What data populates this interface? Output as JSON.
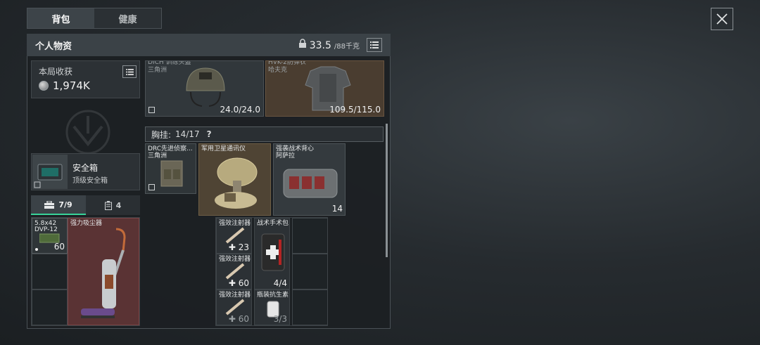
{
  "tabs": [
    {
      "label": "背包"
    },
    {
      "label": "健康"
    }
  ],
  "panel": {
    "title": "个人物资",
    "weight_current": "33.5",
    "weight_max": "/88千克"
  },
  "loot": {
    "title": "本局收获",
    "value": "1,974K"
  },
  "safe_box": {
    "name": "安全箱",
    "subtitle": "顶级安全箱"
  },
  "subtabs": [
    {
      "label": "7/9",
      "icon": "toolbox-icon"
    },
    {
      "label": "4",
      "icon": "canister-icon"
    }
  ],
  "left_items": {
    "ammo": {
      "label1": "5.8x42",
      "label2": "DVP-12",
      "count": "60"
    },
    "vacuum": {
      "label": "强力吸尘器"
    }
  },
  "equipment": {
    "helmet": {
      "label1": "DICH 训练头盔",
      "label2": "三角洲",
      "durability": "24.0/24.0"
    },
    "armor": {
      "label1": "HVK-2防弹衣",
      "label2": "哈夫克",
      "durability": "109.5/115.0"
    }
  },
  "chest_rig": {
    "label": "胸挂:",
    "capacity": "14/17",
    "help": "?"
  },
  "rig_items": {
    "rig": {
      "label1": "DRC先进侦察...",
      "label2": "三角洲"
    },
    "radio": {
      "label": "军用卫星通讯仪"
    },
    "backpack": {
      "label1": "强袭战术背心",
      "label2": "阿萨拉",
      "capacity": "14"
    }
  },
  "pouch_items": [
    {
      "label": "强效注射器",
      "count": "23"
    },
    {
      "label": "战术手术包",
      "count": "4/4"
    },
    {
      "label": "强效注射器",
      "count": "60"
    },
    {
      "label": "强效注射器",
      "count": "60"
    },
    {
      "label": "瓶装抗生素",
      "count": "3/3"
    }
  ],
  "colors": {
    "accent_green": "#38d399",
    "highlight_red": "#5a3334",
    "gold": "#4f4434"
  }
}
